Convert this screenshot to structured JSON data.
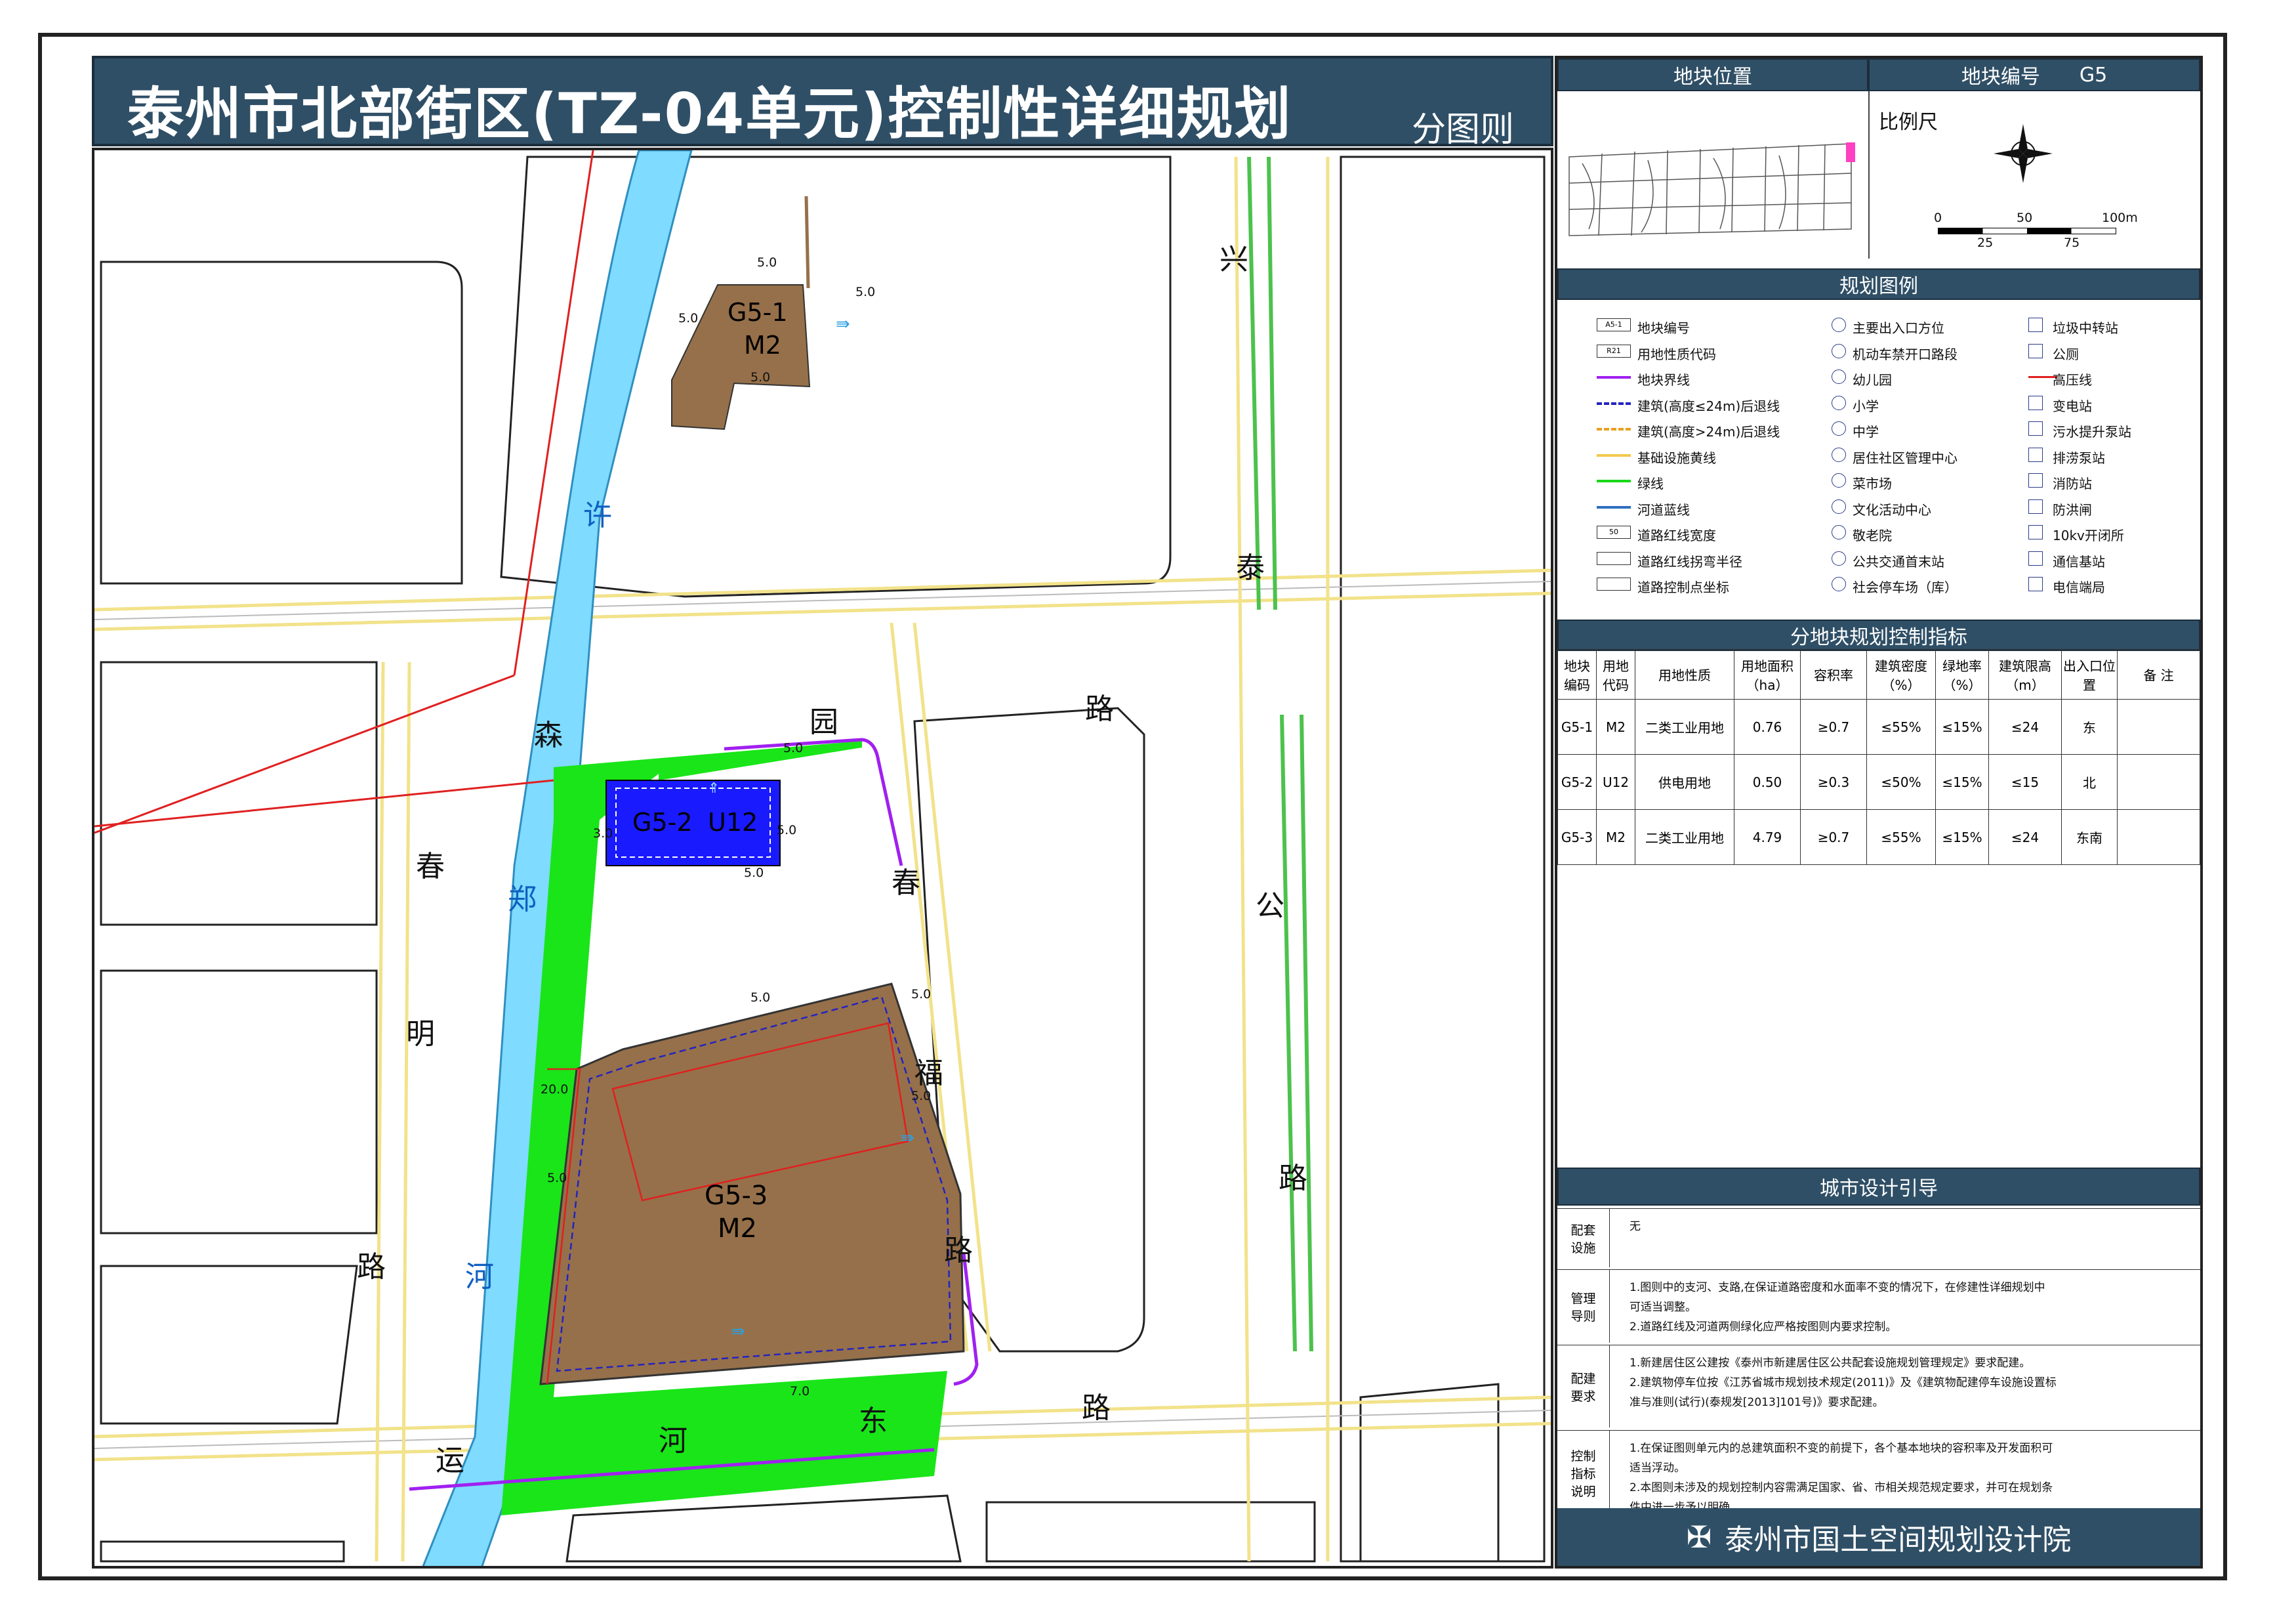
{
  "title": "泰州市北部街区(TZ-04单元)控制性详细规划",
  "subtitle": "分图则",
  "map": {
    "roads": [
      "兴",
      "泰",
      "公",
      "路",
      "森",
      "园",
      "路",
      "春",
      "福",
      "路",
      "春",
      "明",
      "路",
      "运",
      "河",
      "东",
      "路"
    ],
    "river": [
      "许",
      "郑",
      "河"
    ],
    "parcels": [
      {
        "code": "G5-1",
        "use": "M2"
      },
      {
        "code": "G5-2",
        "use": "U12"
      },
      {
        "code": "G5-3",
        "use": "M2"
      }
    ],
    "dims": [
      "5.0",
      "5.0",
      "5.0",
      "5.0",
      "5.0",
      "3.0",
      "5.0",
      "5.0",
      "5.0",
      "20.0",
      "5.0",
      "5.0",
      "5.0",
      "7.0"
    ]
  },
  "panel": {
    "location_header": "地块位置",
    "code_header_label": "地块编号",
    "code_header_value": "G5",
    "scale_label": "比例尺",
    "scale_ticks": [
      "0",
      "50",
      "100m",
      "25",
      "75"
    ],
    "legend_header": "规划图例",
    "legend_col1": [
      "地块编号",
      "用地性质代码",
      "地块界线",
      "建筑(高度≤24m)后退线",
      "建筑(高度>24m)后退线",
      "基础设施黄线",
      "绿线",
      "河道蓝线",
      "道路红线宽度",
      "道路红线拐弯半径",
      "道路控制点坐标"
    ],
    "legend_col1_icons": [
      "A5-1",
      "R21",
      "",
      "",
      "",
      "",
      "",
      "",
      "50",
      "",
      ""
    ],
    "legend_col2": [
      "主要出入口方位",
      "机动车禁开口路段",
      "幼儿园",
      "小学",
      "中学",
      "居住社区管理中心",
      "菜市场",
      "文化活动中心",
      "敬老院",
      "公共交通首末站",
      "社会停车场（库）"
    ],
    "legend_col3": [
      "垃圾中转站",
      "公厕",
      "高压线",
      "变电站",
      "污水提升泵站",
      "排涝泵站",
      "消防站",
      "防洪闸",
      "10kv开闭所",
      "通信基站",
      "电信端局"
    ],
    "index_header": "分地块规划控制指标",
    "index_cols": [
      "地块编码",
      "用地代码",
      "用地性质",
      "用地面积（ha）",
      "容积率",
      "建筑密度（%）",
      "绿地率（%）",
      "建筑限高（m）",
      "出入口位置",
      "备 注"
    ],
    "index_rows": [
      [
        "G5-1",
        "M2",
        "二类工业用地",
        "0.76",
        "≥0.7",
        "≤55%",
        "≤15%",
        "≤24",
        "东",
        ""
      ],
      [
        "G5-2",
        "U12",
        "供电用地",
        "0.50",
        "≥0.3",
        "≤50%",
        "≤15%",
        "≤15",
        "北",
        ""
      ],
      [
        "G5-3",
        "M2",
        "二类工业用地",
        "4.79",
        "≥0.7",
        "≤55%",
        "≤15%",
        "≤24",
        "东南",
        ""
      ]
    ],
    "guide_header": "城市设计引导",
    "guide_rows": [
      {
        "label": "配套设施",
        "text": [
          "无"
        ]
      },
      {
        "label": "管理导则",
        "text": [
          "1.图则中的支河、支路,在保证道路密度和水面率不变的情况下，在修建性详细规划中",
          "可适当调整。",
          "2.道路红线及河道两侧绿化应严格按图则内要求控制。"
        ]
      },
      {
        "label": "配建要求",
        "text": [
          "1.新建居住区公建按《泰州市新建居住区公共配套设施规划管理规定》要求配建。",
          "2.建筑物停车位按《江苏省城市规划技术规定(2011)》及《建筑物配建停车设施设置标",
          "准与准则(试行)(泰规发[2013]101号)》要求配建。"
        ]
      },
      {
        "label": "控制指标说明",
        "text": [
          "1.在保证图则单元内的总建筑面积不变的前提下，各个基本地块的容积率及开发面积可",
          "适当浮动。",
          "2.本图则未涉及的规划控制内容需满足国家、省、市相关规范规定要求，并可在规划条",
          "件中进一步予以明确。"
        ]
      }
    ],
    "org": "泰州市国土空间规划设计院"
  }
}
